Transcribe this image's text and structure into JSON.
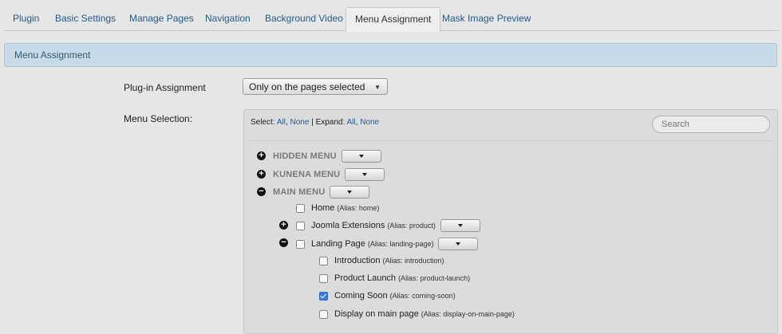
{
  "tabs": [
    "Plugin",
    "Basic Settings",
    "Manage Pages",
    "Navigation",
    "Background Video",
    "Menu Assignment",
    "Mask Image Preview"
  ],
  "active_tab": "Menu Assignment",
  "banner": "Menu Assignment",
  "assignment": {
    "label": "Plug-in Assignment",
    "value": "Only on the pages selected"
  },
  "menu_selection": {
    "label": "Menu Selection:",
    "select_label": "Select:",
    "select_all": "All",
    "select_none": "None",
    "expand_label": "Expand:",
    "expand_all": "All",
    "expand_none": "None",
    "search_placeholder": "Search"
  },
  "menus": [
    {
      "name": "HIDDEN MENU",
      "expanded": false
    },
    {
      "name": "KUNENA MENU",
      "expanded": false
    },
    {
      "name": "MAIN MENU",
      "expanded": true
    }
  ],
  "items": [
    {
      "title": "Home",
      "alias": "(Alias: home)",
      "checked": false
    },
    {
      "title": "Joomla Extensions",
      "alias": "(Alias: product)",
      "checked": false
    },
    {
      "title": "Landing Page",
      "alias": "(Alias: landing-page)",
      "checked": false
    },
    {
      "title": "Introduction",
      "alias": "(Alias: introduction)",
      "checked": false
    },
    {
      "title": "Product Launch",
      "alias": "(Alias: product-launch)",
      "checked": false
    },
    {
      "title": "Coming Soon",
      "alias": "(Alias: coming-soon)",
      "checked": true
    },
    {
      "title": "Display on main page",
      "alias": "(Alias: display-on-main-page)",
      "checked": false
    }
  ],
  "icons": {
    "expand": "plus-circle-icon",
    "collapse": "minus-circle-icon",
    "dropdown": "caret-down-icon"
  }
}
